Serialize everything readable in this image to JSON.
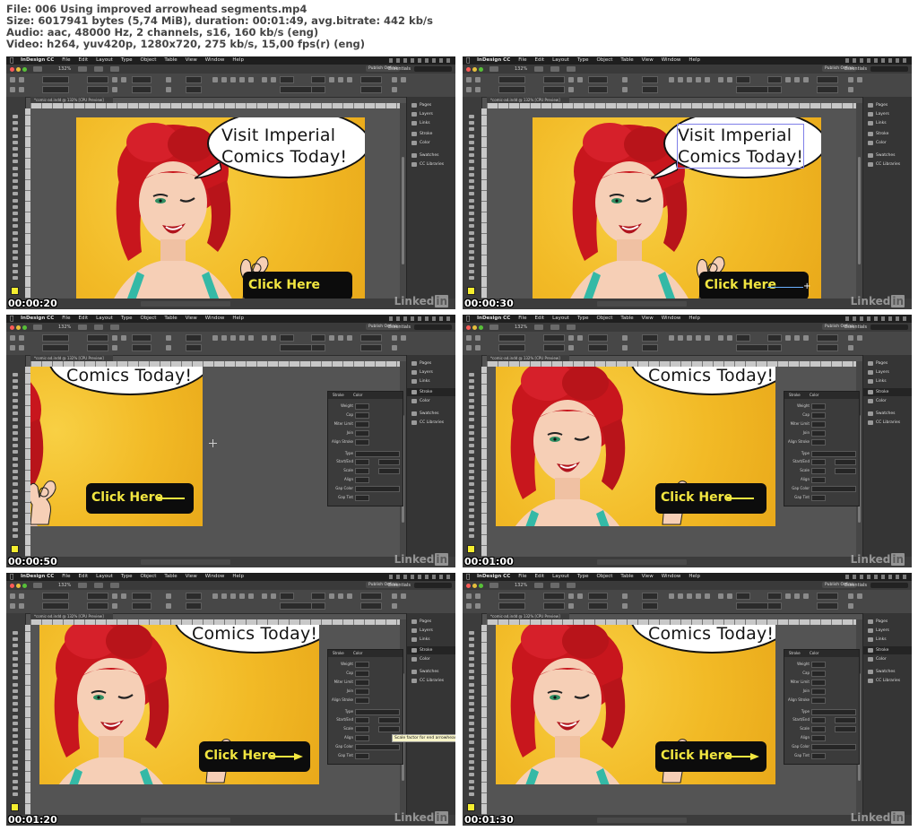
{
  "header": {
    "file_line": "File: 006 Using improved arrowhead segments.mp4",
    "size_line": "Size: 6017941 bytes (5,74 MiB), duration: 00:01:49, avg.bitrate: 442 kb/s",
    "audio_line": "Audio: aac, 48000 Hz, 2 channels, s16, 160 kb/s (eng)",
    "video_line": "Video: h264, yuv420p, 1280x720, 275 kb/s, 15,00 fps(r) (eng)"
  },
  "app": {
    "menus": [
      "InDesign CC",
      "File",
      "Edit",
      "Layout",
      "Type",
      "Object",
      "Table",
      "View",
      "Window",
      "Help"
    ],
    "zoom": "132%",
    "publish_label": "Publish Online",
    "workspace_label": "Essentials",
    "doc_tab": "*comic-ad.indd @ 132% [CPU Preview]"
  },
  "panels": {
    "items": [
      "Pages",
      "Layers",
      "Links",
      "Stroke",
      "Color",
      "Swatches",
      "CC Libraries"
    ]
  },
  "artwork": {
    "bubble_text": "Visit Imperial\nComics Today!",
    "bubble_text_cropped": "Comics Today!",
    "cta_text": "Click Here"
  },
  "stroke_panel": {
    "tab_stroke": "Stroke",
    "tab_color": "Color",
    "rows": [
      "Weight",
      "Cap",
      "Miter Limit",
      "Join",
      "Align Stroke",
      "Type",
      "Start/End",
      "Scale",
      "Align",
      "Gap Color",
      "Gap Tint"
    ],
    "weight_value": "4 pt",
    "tooltip": "Scale factor for end arrowhead"
  },
  "frames": [
    {
      "timestamp": "00:00:20"
    },
    {
      "timestamp": "00:00:30"
    },
    {
      "timestamp": "00:00:50"
    },
    {
      "timestamp": "00:01:00"
    },
    {
      "timestamp": "00:01:20"
    },
    {
      "timestamp": "00:01:30"
    }
  ],
  "watermark": {
    "prefix": "Linked",
    "badge": "in"
  },
  "colors": {
    "artboard_yellow": "#f2ba26",
    "cta_text_yellow": "#f2e640",
    "ui_dark": "#535353",
    "menu_bg": "#1e1e1e"
  }
}
